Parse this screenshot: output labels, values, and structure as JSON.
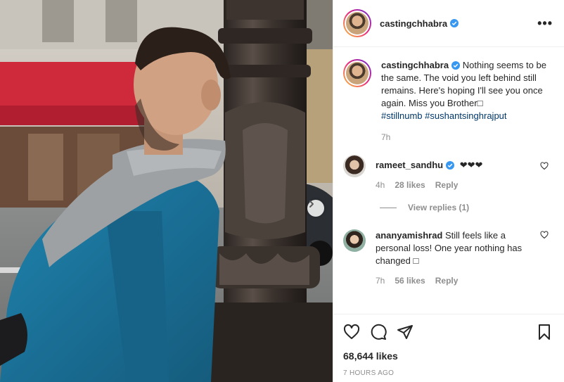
{
  "post": {
    "username": "castingchhabra",
    "more_label": "•••",
    "caption": {
      "username": "castingchhabra",
      "text": "Nothing seems to be the same. The void you left behind still remains. Here's hoping I'll see you once again. Miss you Brother□",
      "hashtags": [
        "#stillnumb",
        "#sushantsinghrajput"
      ],
      "time": "7h"
    },
    "comments": [
      {
        "username": "rameet_sandhu",
        "verified": true,
        "text": "❤❤❤",
        "time": "4h",
        "likes": "28 likes",
        "reply_label": "Reply",
        "view_replies": "View replies (1)"
      },
      {
        "username": "ananyamishrad",
        "verified": false,
        "text": "Still feels like a personal loss! One year nothing has changed □",
        "time": "7h",
        "likes": "56 likes",
        "reply_label": "Reply"
      }
    ],
    "likes_count": "68,644 likes",
    "posted_ago": "7 HOURS AGO"
  },
  "icons": {
    "like": "heart-icon",
    "comment": "comment-icon",
    "share": "paper-plane-icon",
    "save": "bookmark-icon",
    "verified": "verified-badge-icon",
    "next": "chevron-right-icon"
  },
  "colors": {
    "verified": "#3897f0",
    "hashtag": "#00376b",
    "muted": "#8e8e8e",
    "text": "#262626",
    "border": "#efefef"
  }
}
